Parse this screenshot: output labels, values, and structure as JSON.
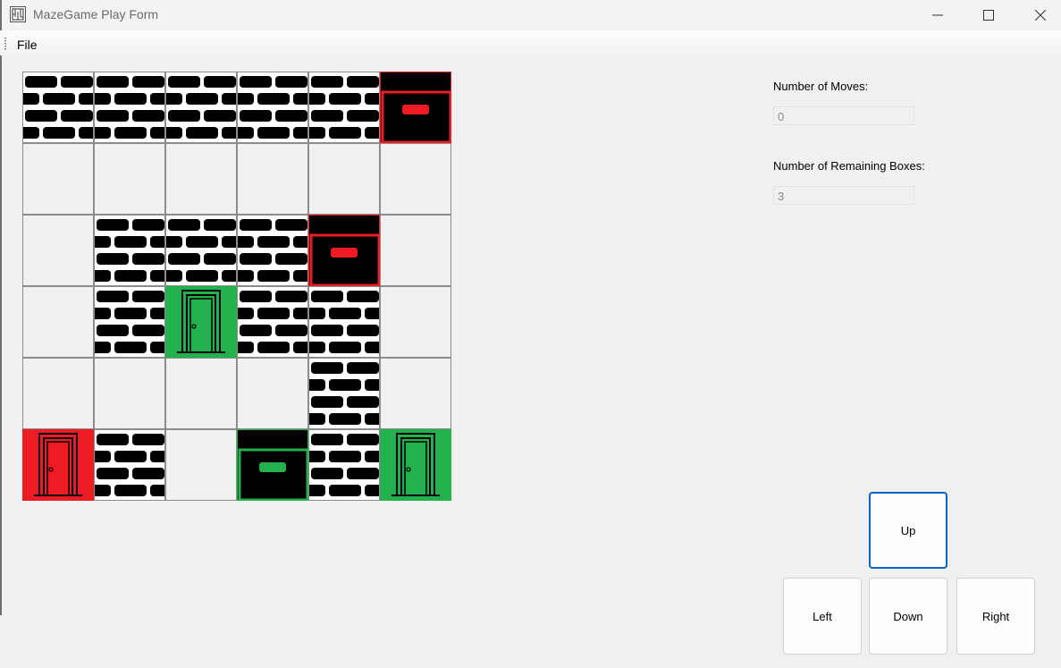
{
  "window": {
    "title": "MazeGame Play Form"
  },
  "menu": {
    "file_label": "File"
  },
  "board": {
    "rows": 6,
    "cols": 6,
    "cells": [
      [
        "wall",
        "wall",
        "wall",
        "wall",
        "wall",
        "red-box"
      ],
      [
        "empty",
        "empty",
        "empty",
        "empty",
        "empty",
        "empty"
      ],
      [
        "empty",
        "wall",
        "wall",
        "wall",
        "red-box",
        "empty"
      ],
      [
        "empty",
        "wall",
        "green-door",
        "wall",
        "wall",
        "empty"
      ],
      [
        "empty",
        "empty",
        "empty",
        "empty",
        "wall",
        "empty"
      ],
      [
        "red-door",
        "wall",
        "empty",
        "green-box",
        "wall",
        "green-door"
      ]
    ]
  },
  "stats": {
    "moves_label": "Number of Moves:",
    "moves_value": "0",
    "remaining_label": "Number of Remaining Boxes:",
    "remaining_value": "3"
  },
  "controls": {
    "up": "Up",
    "left": "Left",
    "down": "Down",
    "right": "Right"
  },
  "colors": {
    "red": "#ed1c24",
    "green": "#22b14c",
    "wall": "#000000",
    "focus": "#0a64c8"
  }
}
